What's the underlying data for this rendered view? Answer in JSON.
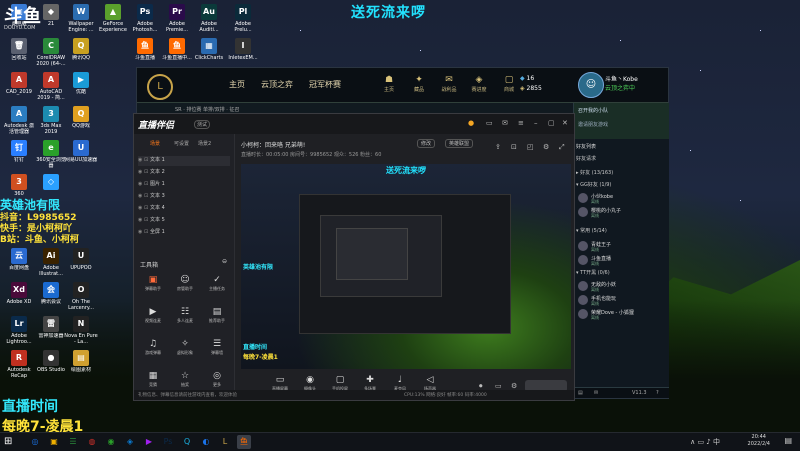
{
  "overlay": {
    "top_title": "送死流来啰",
    "stream_name": "英雄池有限",
    "douyin": "抖音：L9985652",
    "kuaishou": "快手：是小柯柯吖",
    "bilibili": "B站：斗鱼、小柯柯",
    "live_time_title": "直播时间",
    "live_time_value": "每晚7-凌晨1",
    "watermark_main": "斗鱼",
    "watermark_sub": "DOUYU.COM"
  },
  "desktop": {
    "icons": [
      {
        "label": "此电脑",
        "glyph": "▣",
        "color": "#3a7bd5"
      },
      {
        "label": "21",
        "glyph": "◆",
        "color": "#666"
      },
      {
        "label": "Wallpaper Engine: ...",
        "glyph": "W",
        "color": "#2b6cb0"
      },
      {
        "label": "GeForce Experience",
        "glyph": "▲",
        "color": "#5aa02c"
      },
      {
        "label": "Adobe Photosh...",
        "glyph": "Ps",
        "color": "#0b2a4a"
      },
      {
        "label": "Adobe Premie...",
        "glyph": "Pr",
        "color": "#2a0b4a"
      },
      {
        "label": "Adobe Auditi...",
        "glyph": "Au",
        "color": "#0b3a3a"
      },
      {
        "label": "Adobe Prelu...",
        "glyph": "Pl",
        "color": "#0b2a3a"
      },
      {
        "label": "回收站",
        "glyph": "🗑",
        "color": "#5a6070"
      },
      {
        "label": "CorelDRAW 2020 (64-...",
        "glyph": "C",
        "color": "#2a8a3a"
      },
      {
        "label": "腾讯QQ",
        "glyph": "Q",
        "color": "#c8a020"
      },
      {
        "label": "斗鱼直播",
        "glyph": "鱼",
        "color": "#ff6a00"
      },
      {
        "label": "斗鱼直播中...",
        "glyph": "鱼",
        "color": "#ff6a00"
      },
      {
        "label": "ClickCharts",
        "glyph": "▦",
        "color": "#2a6ab0"
      },
      {
        "label": "InletexEM...",
        "glyph": "I",
        "color": "#333"
      },
      {
        "label": "CAD_2019",
        "glyph": "A",
        "color": "#c0392b"
      },
      {
        "label": "AutoCAD 2019 - 简...",
        "glyph": "A",
        "color": "#c0392b"
      },
      {
        "label": "优酷",
        "glyph": "▶",
        "color": "#1a9bd7"
      },
      {
        "label": "Autodesk 激活管理器",
        "glyph": "A",
        "color": "#2b7dc1"
      },
      {
        "label": "3ds Max 2019",
        "glyph": "3",
        "color": "#1c8bb0"
      },
      {
        "label": "QQ游戏",
        "glyph": "Q",
        "color": "#e0a020"
      },
      {
        "label": "钉钉",
        "glyph": "钉",
        "color": "#2a7fff"
      },
      {
        "label": "360安全浏览器",
        "glyph": "e",
        "color": "#2aa02a"
      },
      {
        "label": "网易UU加速器",
        "glyph": "U",
        "color": "#2a6ad0"
      },
      {
        "label": "360",
        "glyph": "3",
        "color": "#d05020"
      },
      {
        "label": "",
        "glyph": "◇",
        "color": "#2aa0ff"
      },
      {
        "label": "百度网盘",
        "glyph": "云",
        "color": "#2a6ad0"
      },
      {
        "label": "Adobe Illustrat...",
        "glyph": "Ai",
        "color": "#3a2200"
      },
      {
        "label": "UPUPOO",
        "glyph": "U",
        "color": "#222"
      },
      {
        "label": "Adobe XD",
        "glyph": "Xd",
        "color": "#4a0a3a"
      },
      {
        "label": "腾讯会议",
        "glyph": "会",
        "color": "#1a6ad0"
      },
      {
        "label": "Oh The Larcenry...",
        "glyph": "O",
        "color": "#222"
      },
      {
        "label": "Adobe Lightroo...",
        "glyph": "Lr",
        "color": "#0a2a4a"
      },
      {
        "label": "雷神加速器",
        "glyph": "雷",
        "color": "#444"
      },
      {
        "label": "Nova En Pure - La...",
        "glyph": "N",
        "color": "#222"
      },
      {
        "label": "Autodesk ReCap",
        "glyph": "R",
        "color": "#c03020"
      },
      {
        "label": "OBS Studio",
        "glyph": "●",
        "color": "#333"
      },
      {
        "label": "绘图素材",
        "glyph": "▤",
        "color": "#d0a030"
      }
    ]
  },
  "lol": {
    "tabs": [
      "主页",
      "云顶之弈",
      "冠军杯赛"
    ],
    "nav_icons": [
      {
        "glyph": "☗",
        "label": "主页"
      },
      {
        "glyph": "✦",
        "label": "藏品"
      },
      {
        "glyph": "✉",
        "label": "战利品"
      },
      {
        "glyph": "◈",
        "label": "赛进度"
      },
      {
        "glyph": "▢",
        "label": "商城"
      }
    ],
    "currency_be": "16",
    "currency_rp": "2855",
    "summoner_name": "斗鱼丶Kobe",
    "summoner_status": "云顶之弈中",
    "level": "326",
    "subnav": [
      "SR · 排位赛 单排/双排 · 征召"
    ],
    "friends": {
      "party_label": "召开我的小队",
      "party_sub": "邀请朋友游戏",
      "friends_list_label": "好友列表",
      "groups": [
        {
          "name": "好友请求",
          "count": ""
        },
        {
          "name": "▸ 好友 (13/163)",
          "count": ""
        },
        {
          "name": "▾ GG好友 (1/9)",
          "count": ""
        },
        {
          "name": "▾ 常用 (5/14)",
          "count": ""
        },
        {
          "name": "▾ TT开黑 (0/6)",
          "count": ""
        }
      ],
      "entries": [
        {
          "name": "小伙kobe",
          "status": "离线"
        },
        {
          "name": "樱桃的小丸子",
          "status": "离线"
        },
        {
          "name": "青蛙王子",
          "status": "离线"
        },
        {
          "name": "斗鱼直播",
          "status": "离线"
        },
        {
          "name": "无敌的小妖",
          "status": "离线"
        },
        {
          "name": "手机也能玩",
          "status": "离线"
        },
        {
          "name": "荣耀Dove - 小狐狸",
          "status": "离线"
        }
      ],
      "footer_version": "V11.3"
    }
  },
  "douyu": {
    "logo": "直播伴侣",
    "beta": "测试",
    "scene_tabs": [
      "场景",
      "可设置",
      "场景2"
    ],
    "scenes": [
      "文本 1",
      "文本 2",
      "图片 1",
      "文本 3",
      "文本 4",
      "文本 5",
      "全屏 1"
    ],
    "tools_title": "工具箱",
    "tools": [
      {
        "glyph": "▣",
        "label": "弹幕助手"
      },
      {
        "glyph": "☺",
        "label": "房管助手"
      },
      {
        "glyph": "✓",
        "label": "主播任务"
      },
      {
        "glyph": "▶",
        "label": "视频连麦"
      },
      {
        "glyph": "☷",
        "label": "多人连麦"
      },
      {
        "glyph": "▤",
        "label": "推荐助手"
      },
      {
        "glyph": "♫",
        "label": "游戏弹幕"
      },
      {
        "glyph": "✧",
        "label": "虚拟形象"
      },
      {
        "glyph": "☰",
        "label": "弹幕墙"
      },
      {
        "glyph": "▦",
        "label": "竞猜"
      },
      {
        "glyph": "☆",
        "label": "抽奖"
      },
      {
        "glyph": "◎",
        "label": "更多"
      }
    ],
    "room_title": "小柯柯：回来咯 兄弟萌!",
    "edit_label": "修改",
    "category_label": "英雄联盟",
    "stats": "直播时长：00:05:00   房间号：9985652   观众：526   粉丝：60",
    "caption": "送死流来啰",
    "preview_tags": [
      "英雄池有限",
      "直播时间",
      "每晚7-凌晨1"
    ],
    "bottom_buttons": [
      {
        "glyph": "▭",
        "label": "直播屏幕"
      },
      {
        "glyph": "◉",
        "label": "摄像头"
      },
      {
        "glyph": "▢",
        "label": "手机投屏"
      },
      {
        "glyph": "✚",
        "label": "多场景"
      },
      {
        "glyph": "♩",
        "label": "麦克风"
      },
      {
        "glyph": "◁",
        "label": "扬声器"
      }
    ],
    "status_text": "礼物信息、弹幕信息请前往游戏内查看，欢迎体验",
    "status_right": "CPU:13%  网络:良好  帧率:60  码率:4000"
  },
  "taskbar": {
    "apps": [
      {
        "glyph": "◎",
        "color": "#1a73e8"
      },
      {
        "glyph": "▣",
        "color": "#f0b000"
      },
      {
        "glyph": "☰",
        "color": "#2a8a3a"
      },
      {
        "glyph": "◍",
        "color": "#d0302a"
      },
      {
        "glyph": "◉",
        "color": "#2aa02a"
      },
      {
        "glyph": "◈",
        "color": "#0a7ad0"
      },
      {
        "glyph": "▶",
        "color": "#a020f0"
      },
      {
        "glyph": "Ps",
        "color": "#0b2a4a"
      },
      {
        "glyph": "Q",
        "color": "#1ab0e0"
      },
      {
        "glyph": "◐",
        "color": "#1a73e8"
      },
      {
        "glyph": "L",
        "color": "#c8a44a"
      },
      {
        "glyph": "鱼",
        "color": "#ff6a00"
      }
    ],
    "time": "20:44",
    "date": "2022/2/4",
    "tray": "∧ ▭ ♪ 中"
  }
}
